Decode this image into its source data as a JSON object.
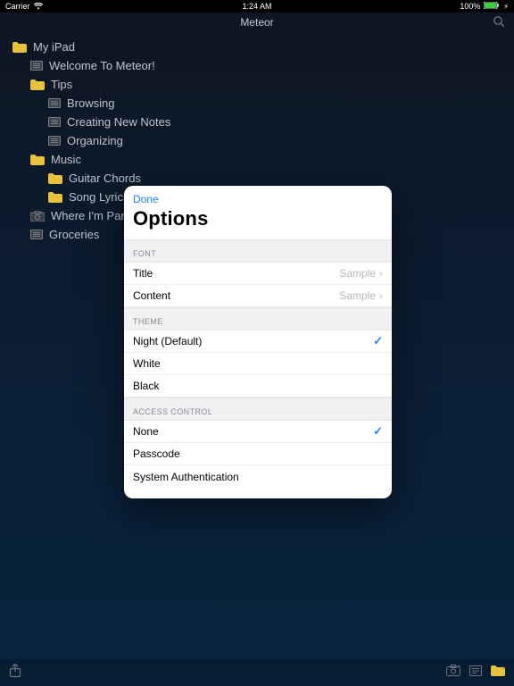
{
  "status": {
    "carrier": "Carrier",
    "time": "1:24 AM",
    "battery": "100%"
  },
  "nav": {
    "title": "Meteor"
  },
  "tree": {
    "root": {
      "label": "My iPad"
    },
    "welcome": {
      "label": "Welcome To Meteor!"
    },
    "tips": {
      "label": "Tips"
    },
    "tips_children": {
      "browsing": "Browsing",
      "creating": "Creating New Notes",
      "organizing": "Organizing"
    },
    "music": {
      "label": "Music"
    },
    "music_children": {
      "chords": "Guitar Chords",
      "lyrics": "Song Lyrics"
    },
    "parked": "Where I'm Parked",
    "groceries": "Groceries"
  },
  "modal": {
    "done": "Done",
    "title": "Options",
    "sections": {
      "font": {
        "header": "FONT",
        "title_row": {
          "label": "Title",
          "value": "Sample"
        },
        "content_row": {
          "label": "Content",
          "value": "Sample"
        }
      },
      "theme": {
        "header": "THEME",
        "night": "Night (Default)",
        "white": "White",
        "black": "Black",
        "selected": "night"
      },
      "access": {
        "header": "ACCESS CONTROL",
        "none": "None",
        "passcode": "Passcode",
        "system": "System Authentication",
        "selected": "none"
      }
    }
  }
}
